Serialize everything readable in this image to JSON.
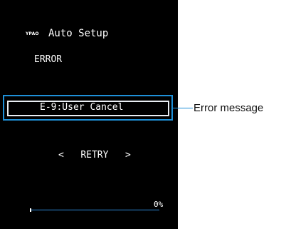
{
  "screen": {
    "logo": "YPAO",
    "title": "Auto Setup",
    "error_label": "ERROR",
    "error_message": "E-9:User Cancel",
    "retry": {
      "prev_arrow": "<",
      "label": "RETRY",
      "next_arrow": ">"
    },
    "progress": {
      "label": "0%",
      "value": 0
    }
  },
  "annotation": {
    "label": "Error message"
  },
  "colors": {
    "screen_bg": "#000000",
    "highlight": "#1e90d8",
    "progress_track": "#0e2a42",
    "text": "#ffffff"
  }
}
